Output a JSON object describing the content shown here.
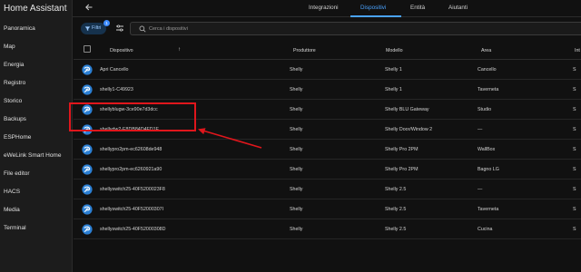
{
  "app_title": "Home Assistant",
  "sidebar": {
    "items": [
      {
        "label": "Panoramica"
      },
      {
        "label": "Map"
      },
      {
        "label": "Energia"
      },
      {
        "label": "Registro"
      },
      {
        "label": "Storico"
      },
      {
        "label": "Backups"
      },
      {
        "label": "ESPHome"
      },
      {
        "label": "eWeLink Smart Home"
      },
      {
        "label": "File editor"
      },
      {
        "label": "HACS"
      },
      {
        "label": "Media"
      },
      {
        "label": "Terminal"
      }
    ]
  },
  "tabs": [
    {
      "label": "Integrazioni"
    },
    {
      "label": "Dispositivi",
      "active": true
    },
    {
      "label": "Entità"
    },
    {
      "label": "Aiutanti"
    }
  ],
  "filters": {
    "button_label": "Filtri",
    "badge": "1",
    "search_placeholder": "Cerca i dispositivi"
  },
  "table": {
    "columns": [
      "Dispositivo",
      "Produttore",
      "Modello",
      "Area",
      "Int"
    ],
    "rows": [
      {
        "name": "Apri Cancello",
        "manufacturer": "Shelly",
        "model": "Shelly 1",
        "area": "Cancello",
        "integration": "S"
      },
      {
        "name": "shelly1-C49923",
        "manufacturer": "Shelly",
        "model": "Shelly 1",
        "area": "Taverneta",
        "integration": "S"
      },
      {
        "name": "shellyblugw-3ce90e7d3dcc",
        "manufacturer": "Shelly",
        "model": "Shelly BLU Gateway",
        "area": "Studio",
        "integration": "S"
      },
      {
        "name": "shellydw2-E8DB84D4FD1E",
        "manufacturer": "Shelly",
        "model": "Shelly Door/Window 2",
        "area": "—",
        "integration": "S"
      },
      {
        "name": "shellypro2pm-ec62608de948",
        "manufacturer": "Shelly",
        "model": "Shelly Pro 2PM",
        "area": "WallBox",
        "integration": "S"
      },
      {
        "name": "shellypro2pm-ec6260921a90",
        "manufacturer": "Shelly",
        "model": "Shelly Pro 2PM",
        "area": "Bagno LG",
        "integration": "S"
      },
      {
        "name": "shellyswitch25-40F5200023F8",
        "manufacturer": "Shelly",
        "model": "Shelly 2.5",
        "area": "—",
        "integration": "S"
      },
      {
        "name": "shellyswitch25-40F52000307I",
        "manufacturer": "Shelly",
        "model": "Shelly 2.5",
        "area": "Taverneta",
        "integration": "S"
      },
      {
        "name": "shellyswitch25-40F52000308D",
        "manufacturer": "Shelly",
        "model": "Shelly 2.5",
        "area": "Cucina",
        "integration": "S"
      }
    ]
  },
  "colors": {
    "accent": "#4aa3ff",
    "annotation": "#e0161c",
    "shelly_icon": "#2b7fd3"
  },
  "icons": {
    "back": "arrow-left-icon",
    "filter": "filter-icon",
    "settings": "tune-icon",
    "search": "search-icon",
    "device": "shelly-logo-icon"
  }
}
